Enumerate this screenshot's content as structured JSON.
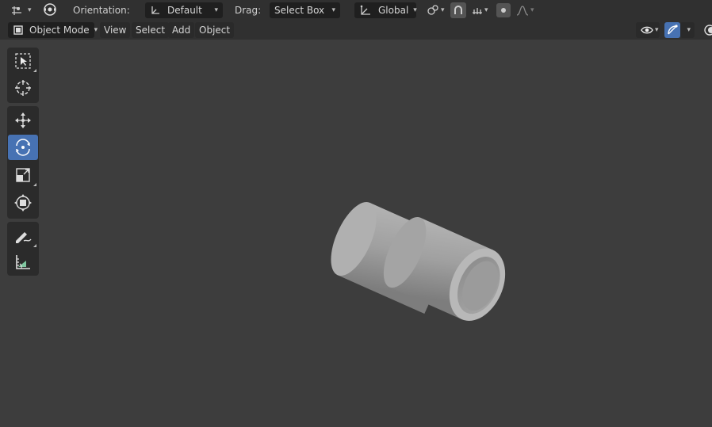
{
  "top_toolbar": {
    "orientation_label": "Orientation:",
    "orientation_value": "Default",
    "drag_label": "Drag:",
    "drag_value": "Select Box",
    "transform_space": "Global"
  },
  "header": {
    "mode": "Object Mode",
    "menus": [
      "View",
      "Select",
      "Add",
      "Object"
    ]
  },
  "tools": [
    {
      "name": "select-box-tool",
      "icon": "select-box-icon"
    },
    {
      "name": "cursor-tool",
      "icon": "cursor-icon"
    },
    {
      "name": "move-tool",
      "icon": "move-icon"
    },
    {
      "name": "rotate-tool",
      "icon": "rotate-icon",
      "active": true
    },
    {
      "name": "scale-tool",
      "icon": "scale-icon"
    },
    {
      "name": "transform-tool",
      "icon": "transform-icon"
    },
    {
      "name": "annotate-tool",
      "icon": "annotate-icon"
    },
    {
      "name": "measure-tool",
      "icon": "measure-icon"
    }
  ],
  "colors": {
    "background": "#3d3d3d",
    "header": "#303030",
    "accent": "#4772b3",
    "object": "#a6a6a6"
  }
}
